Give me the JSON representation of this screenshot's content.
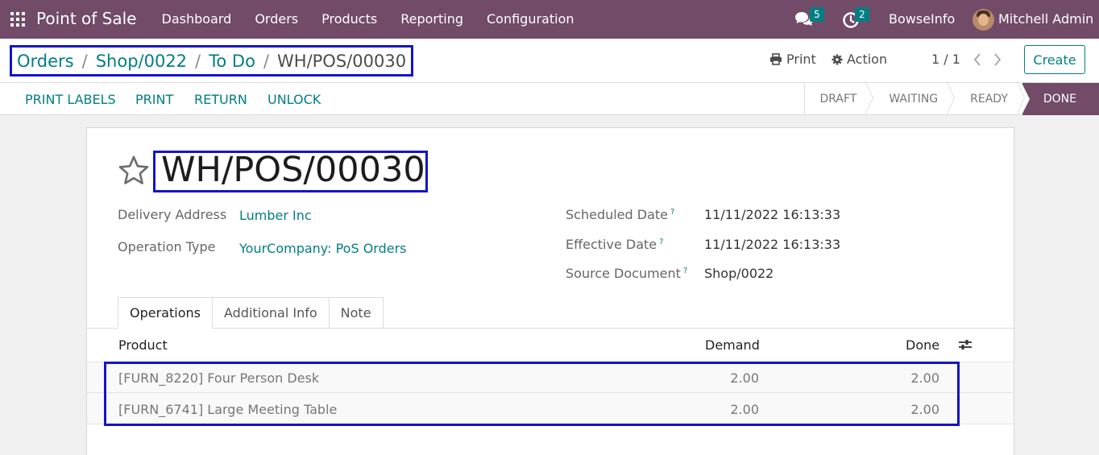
{
  "navbar": {
    "app_name": "Point of Sale",
    "menu": [
      "Dashboard",
      "Orders",
      "Products",
      "Reporting",
      "Configuration"
    ],
    "messages_count": "5",
    "activities_count": "2",
    "company": "BowseInfo",
    "user": "Mitchell Admin"
  },
  "breadcrumb": {
    "items": [
      "Orders",
      "Shop/0022",
      "To Do"
    ],
    "current": "WH/POS/00030",
    "separator": "/"
  },
  "control": {
    "print_label": "Print",
    "action_label": "Action",
    "pager": "1 / 1",
    "create_label": "Create"
  },
  "statusbar": {
    "buttons": [
      "PRINT LABELS",
      "PRINT",
      "RETURN",
      "UNLOCK"
    ],
    "stages": [
      "DRAFT",
      "WAITING",
      "READY",
      "DONE"
    ],
    "current_stage": "DONE"
  },
  "record": {
    "title": "WH/POS/00030",
    "delivery_address_label": "Delivery Address",
    "delivery_address": "Lumber Inc",
    "operation_type_label": "Operation Type",
    "operation_type": "YourCompany: PoS Orders",
    "scheduled_date_label": "Scheduled Date",
    "scheduled_date": "11/11/2022 16:13:33",
    "effective_date_label": "Effective Date",
    "effective_date": "11/11/2022 16:13:33",
    "source_document_label": "Source Document",
    "source_document": "Shop/0022",
    "help_marker": "?"
  },
  "tabs": [
    "Operations",
    "Additional Info",
    "Note"
  ],
  "operations": {
    "columns": [
      "Product",
      "Demand",
      "Done"
    ],
    "rows": [
      {
        "product": "[FURN_8220] Four Person Desk",
        "demand": "2.00",
        "done": "2.00"
      },
      {
        "product": "[FURN_6741] Large Meeting Table",
        "demand": "2.00",
        "done": "2.00"
      }
    ]
  },
  "colors": {
    "brand": "#714b67",
    "link": "#017e84",
    "highlight_box": "#1414c8"
  }
}
